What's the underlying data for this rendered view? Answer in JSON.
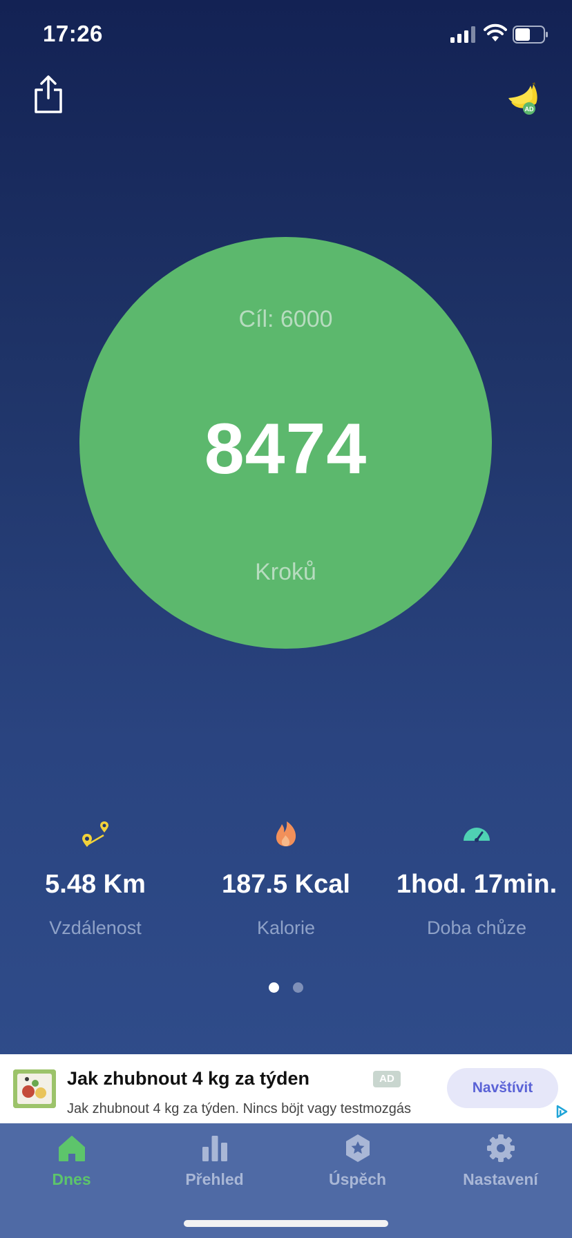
{
  "status_bar": {
    "time": "17:26",
    "battery_level": 0.55
  },
  "steps": {
    "goal_label": "Cíl: 6000",
    "value": "8474",
    "unit_label": "Kroků"
  },
  "stats": [
    {
      "value": "5.48 Km",
      "label": "Vzdálenost",
      "icon": "route-pin-icon"
    },
    {
      "value": "187.5 Kcal",
      "label": "Kalorie",
      "icon": "flame-icon"
    },
    {
      "value": "1hod. 17min.",
      "label": "Doba chůze",
      "icon": "speedometer-icon"
    }
  ],
  "pager": {
    "pages": 2,
    "active": 1
  },
  "ad": {
    "title": "Jak zhubnout 4 kg za týden",
    "badge": "AD",
    "description": "Jak zhubnout 4 kg za týden. Nincs böjt vagy testmozgás",
    "cta": "Navštívit"
  },
  "header": {
    "ad_icon_badge": "AD"
  },
  "tabs": [
    {
      "label": "Dnes",
      "icon": "home-icon",
      "active": true
    },
    {
      "label": "Přehled",
      "icon": "bar-chart-icon",
      "active": false
    },
    {
      "label": "Úspěch",
      "icon": "achievement-badge-icon",
      "active": false
    },
    {
      "label": "Nastavení",
      "icon": "gear-icon",
      "active": false
    }
  ],
  "colors": {
    "background_top": "#132254",
    "background_bottom": "#32508f",
    "circle": "#5cb86d",
    "accent_active": "#5dc56b",
    "tab_bar": "#4f6aa5",
    "stat_label": "#8fa2c8",
    "ad_cta_text": "#5a62d6"
  }
}
